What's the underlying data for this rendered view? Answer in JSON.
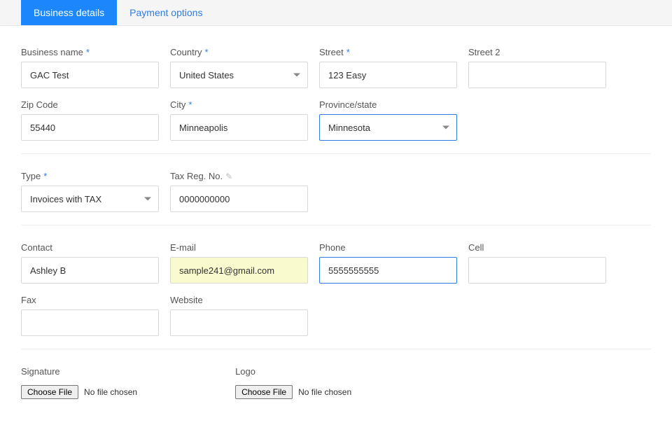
{
  "tabs": {
    "business_details": "Business details",
    "payment_options": "Payment options"
  },
  "labels": {
    "business_name": "Business name",
    "country": "Country",
    "street": "Street",
    "street2": "Street 2",
    "zip": "Zip Code",
    "city": "City",
    "province": "Province/state",
    "type": "Type",
    "tax_reg": "Tax Reg. No.",
    "contact": "Contact",
    "email": "E-mail",
    "phone": "Phone",
    "cell": "Cell",
    "fax": "Fax",
    "website": "Website",
    "signature": "Signature",
    "logo": "Logo",
    "required": "*"
  },
  "values": {
    "business_name": "GAC Test",
    "country": "United States",
    "street": "123 Easy",
    "street2": "",
    "zip": "55440",
    "city": "Minneapolis",
    "province": "Minnesota",
    "type": "Invoices with TAX",
    "tax_reg": "0000000000",
    "contact": "Ashley B",
    "email": "sample241@gmail.com",
    "phone": "5555555555",
    "cell": "",
    "fax": "",
    "website": ""
  },
  "file": {
    "choose": "Choose File",
    "none": "No file chosen"
  }
}
